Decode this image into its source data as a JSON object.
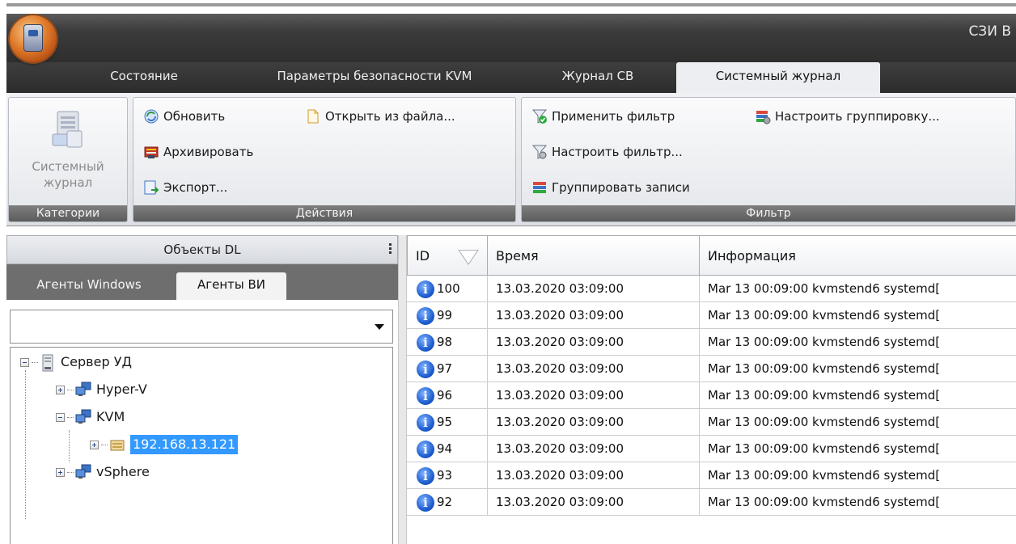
{
  "app": {
    "title": "СЗИ В"
  },
  "tabs": [
    {
      "label": "Состояние",
      "active": false
    },
    {
      "label": "Параметры безопасности KVM",
      "active": false
    },
    {
      "label": "Журнал СВ",
      "active": false
    },
    {
      "label": "Системный журнал",
      "active": true
    }
  ],
  "ribbon": {
    "categories": {
      "label": "Категории",
      "button_line1": "Системный",
      "button_line2": "журнал"
    },
    "actions": {
      "label": "Действия",
      "refresh": "Обновить",
      "open_from_file": "Открыть из файла...",
      "archive": "Архивировать",
      "export": "Экспорт..."
    },
    "filter": {
      "label": "Фильтр",
      "apply_filter": "Применить фильтр",
      "configure_grouping": "Настроить группировку...",
      "configure_filter": "Настроить фильтр...",
      "group_records": "Группировать записи"
    }
  },
  "left_pane": {
    "title": "Объекты DL",
    "tabs": [
      {
        "label": "Агенты Windows",
        "active": false
      },
      {
        "label": "Агенты ВИ",
        "active": true
      }
    ],
    "combo_value": "",
    "tree": {
      "root": "Сервер УД",
      "hyperv": "Hyper-V",
      "kvm": "KVM",
      "kvm_host": "192.168.13.121",
      "vsphere": "vSphere"
    }
  },
  "grid": {
    "columns": {
      "id": "ID",
      "time": "Время",
      "info": "Информация"
    },
    "rows": [
      {
        "id": "100",
        "time": "13.03.2020 03:09:00",
        "info": "Mar 13 00:09:00 kvmstend6 systemd["
      },
      {
        "id": "99",
        "time": "13.03.2020 03:09:00",
        "info": "Mar 13 00:09:00 kvmstend6 systemd["
      },
      {
        "id": "98",
        "time": "13.03.2020 03:09:00",
        "info": "Mar 13 00:09:00 kvmstend6 systemd["
      },
      {
        "id": "97",
        "time": "13.03.2020 03:09:00",
        "info": "Mar 13 00:09:00 kvmstend6 systemd["
      },
      {
        "id": "96",
        "time": "13.03.2020 03:09:00",
        "info": "Mar 13 00:09:00 kvmstend6 systemd["
      },
      {
        "id": "95",
        "time": "13.03.2020 03:09:00",
        "info": "Mar 13 00:09:00 kvmstend6 systemd["
      },
      {
        "id": "94",
        "time": "13.03.2020 03:09:00",
        "info": "Mar 13 00:09:00 kvmstend6 systemd["
      },
      {
        "id": "93",
        "time": "13.03.2020 03:09:00",
        "info": "Mar 13 00:09:00 kvmstend6 systemd["
      },
      {
        "id": "92",
        "time": "13.03.2020 03:09:00",
        "info": "Mar 13 00:09:00 kvmstend6 systemd["
      }
    ]
  },
  "icons": {
    "app_orb": "app-menu-orb-icon",
    "row_info": "info-icon",
    "info_glyph": "i"
  },
  "colors": {
    "selection": "#3399ff",
    "info_blue": "#1f5fd0",
    "tab_bar": "#2e2e2e"
  }
}
